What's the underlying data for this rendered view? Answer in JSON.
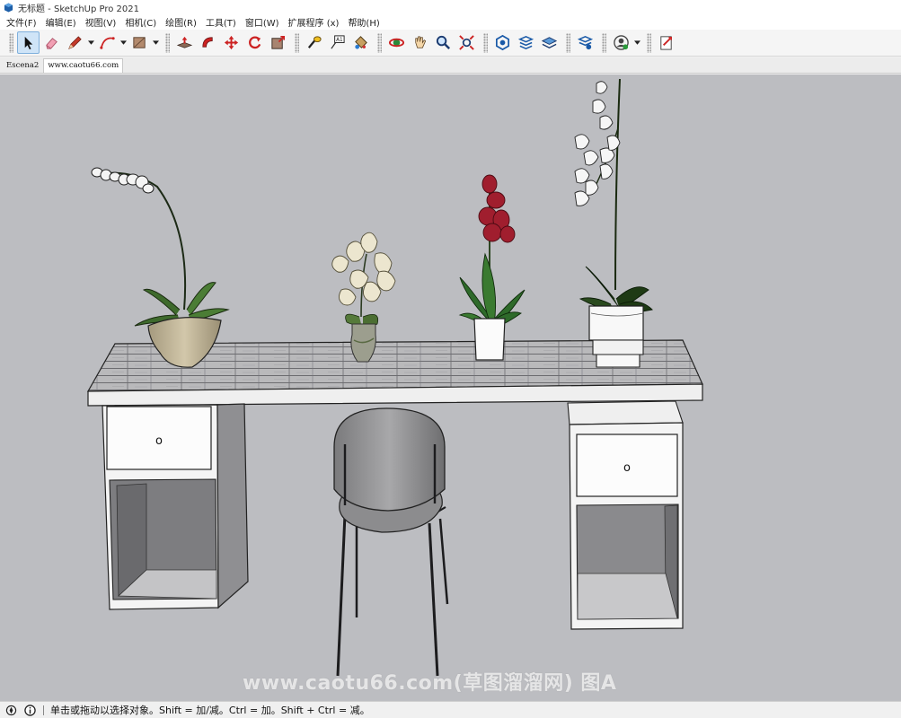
{
  "window": {
    "title": "无标题 - SketchUp Pro 2021",
    "app_icon": "sketchup-icon"
  },
  "menu": {
    "items": [
      "文件(F)",
      "编辑(E)",
      "视图(V)",
      "相机(C)",
      "绘图(R)",
      "工具(T)",
      "窗口(W)",
      "扩展程序 (x)",
      "帮助(H)"
    ]
  },
  "toolbar": {
    "tools": [
      "select-icon",
      "eraser-icon",
      "pencil-line-icon",
      "arc-icon",
      "rectangle-icon",
      "push-pull-icon",
      "follow-me-icon",
      "move-icon",
      "rotate-icon",
      "scale-icon",
      "tape-measure-icon",
      "text-label-icon",
      "paint-bucket-icon",
      "orbit-icon",
      "pan-icon",
      "zoom-icon",
      "zoom-extents-icon",
      "warehouse-icon",
      "extension-warehouse-icon",
      "layer-icon",
      "layer-settings-icon",
      "account-icon",
      "sign-in-icon"
    ],
    "active_tool": "select-icon"
  },
  "tabs": {
    "items": [
      "Escena2",
      "www.caotu66.com"
    ],
    "active": 1
  },
  "viewport": {
    "background_color": "#bcbdc1",
    "watermark": "www.caotu66.com(草图溜溜网) 图A"
  },
  "status": {
    "icons": [
      "geolocation-icon",
      "info-icon"
    ],
    "text": "单击或拖动以选择对象。Shift = 加/减。Ctrl = 加。Shift + Ctrl = 减。"
  }
}
